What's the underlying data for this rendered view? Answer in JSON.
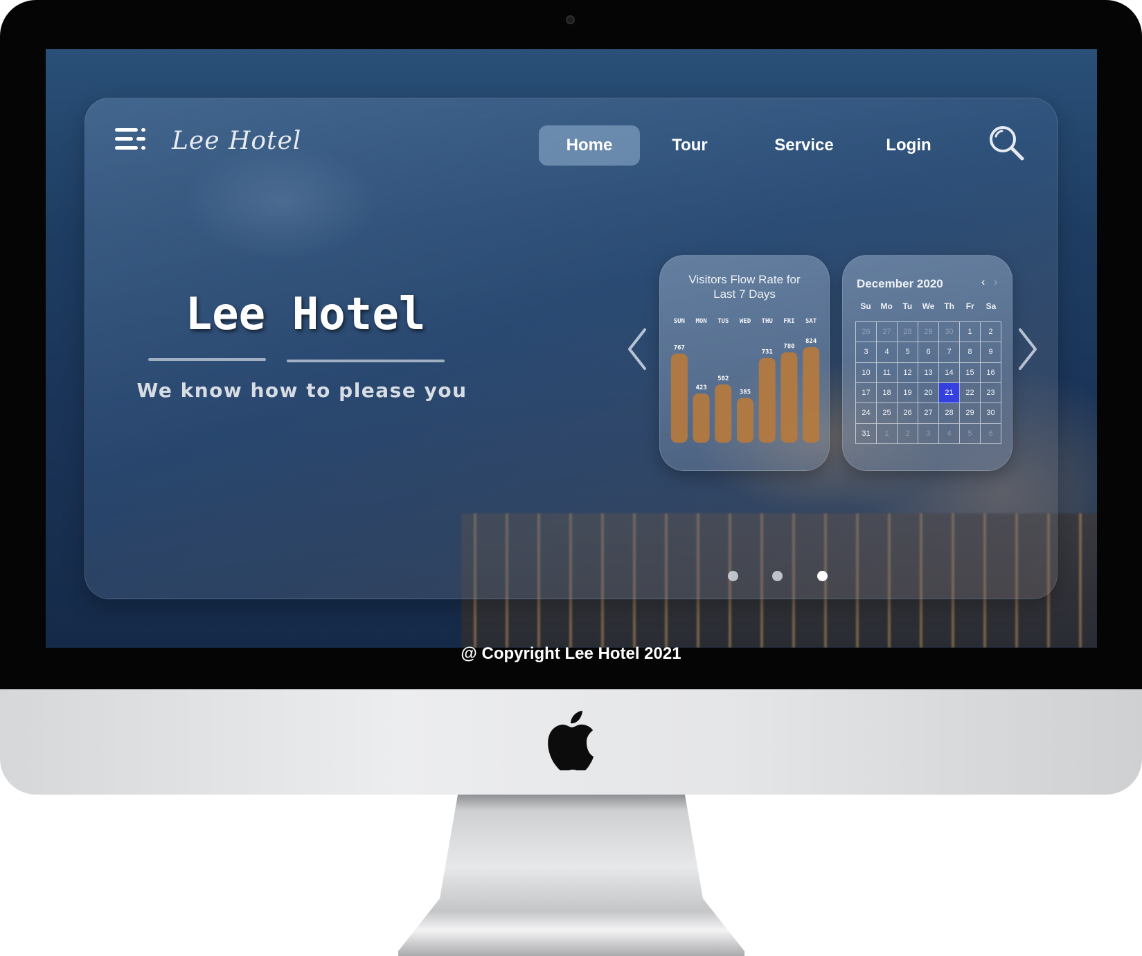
{
  "nav": {
    "brand": "Lee Hotel",
    "items": [
      "Home",
      "Tour",
      "Service",
      "Login"
    ],
    "active": "Home"
  },
  "hero": {
    "title": "Lee Hotel",
    "subtitle": "We know how to please you"
  },
  "chart_card": {
    "title_line1": "Visitors Flow Rate for",
    "title_line2": "Last 7 Days"
  },
  "chart_data": {
    "type": "bar",
    "title": "Visitors Flow Rate for Last 7 Days",
    "categories": [
      "SUN",
      "MON",
      "TUS",
      "WED",
      "THU",
      "FRI",
      "SAT"
    ],
    "values": [
      767,
      423,
      502,
      385,
      731,
      780,
      824
    ],
    "bar_color": "#b87a3c",
    "ylim": [
      0,
      824
    ],
    "grid": false
  },
  "calendar": {
    "month_title": "December 2020",
    "weekdays": [
      "Su",
      "Mo",
      "Tu",
      "We",
      "Th",
      "Fr",
      "Sa"
    ],
    "days": [
      [
        "26",
        "27",
        "28",
        "29",
        "30",
        "1",
        "2"
      ],
      [
        "3",
        "4",
        "5",
        "6",
        "7",
        "8",
        "9"
      ],
      [
        "10",
        "11",
        "12",
        "13",
        "14",
        "15",
        "16"
      ],
      [
        "17",
        "18",
        "19",
        "20",
        "21",
        "22",
        "23"
      ],
      [
        "24",
        "25",
        "26",
        "27",
        "28",
        "29",
        "30"
      ],
      [
        "31",
        "1",
        "2",
        "3",
        "4",
        "5",
        "6"
      ]
    ],
    "selected_day": "21",
    "selected_color": "#3440e0",
    "prev_label": "‹",
    "next_label": "›"
  },
  "carousel": {
    "slides": 3,
    "active_slide": 3
  },
  "footer": {
    "copyright": "@ Copyright Lee Hotel 2021"
  },
  "icons": {
    "menu": "menu-icon",
    "search": "search-icon",
    "arrow_left": "chevron-left-icon",
    "arrow_right": "chevron-right-icon",
    "apple": "apple-logo-icon"
  }
}
